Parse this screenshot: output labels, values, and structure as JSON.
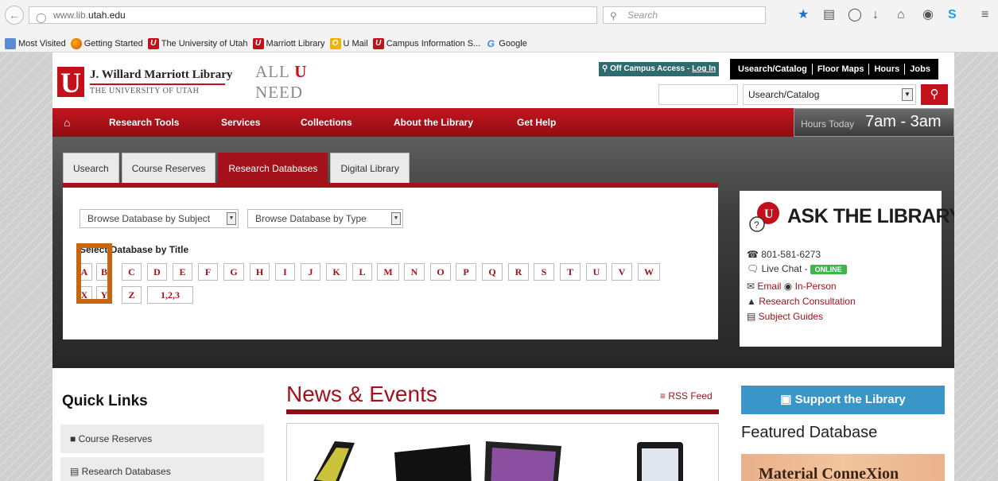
{
  "browser": {
    "url_prefix": "www.lib.",
    "url_domain": "utah.edu",
    "url_suffix": "",
    "search_placeholder": "Search",
    "bookmarks": [
      "Most Visited",
      "Getting Started",
      "The University of Utah",
      "Marriott Library",
      "U Mail",
      "Campus Information S...",
      "Google"
    ]
  },
  "header": {
    "logo_letter": "U",
    "library_name": "J. Willard Marriott Library",
    "university": "THE UNIVERSITY OF UTAH",
    "tagline_all": "ALL",
    "tagline_u": "U",
    "tagline_need": "NEED",
    "off_campus_prefix": "Off Campus Access - ",
    "off_campus_link": "Log In",
    "top_links": [
      "Usearch/Catalog",
      "Floor Maps",
      "Hours",
      "Jobs"
    ],
    "search_select": "Usearch/Catalog"
  },
  "nav": {
    "items": [
      "Research Tools",
      "Services",
      "Collections",
      "About the Library",
      "Get Help"
    ],
    "hours_label": "Hours Today",
    "hours_value": "7am - 3am"
  },
  "tabs": [
    "Usearch",
    "Course Reserves",
    "Research Databases",
    "Digital Library"
  ],
  "active_tab": "Research Databases",
  "databases": {
    "subject_select": "Browse Database by Subject",
    "type_select": "Browse Database by Type",
    "select_title": "Select Database by Title",
    "letters_row1": [
      "A",
      "B",
      "C",
      "D",
      "E",
      "F",
      "G",
      "H",
      "I",
      "J",
      "K",
      "L",
      "M",
      "N",
      "O",
      "P",
      "Q",
      "R",
      "S",
      "T",
      "U",
      "V",
      "W"
    ],
    "letters_row2": [
      "X",
      "Y",
      "Z",
      "1,2,3"
    ]
  },
  "ask": {
    "title": "ASK THE LIBRARY",
    "phone": "801-581-6273",
    "live_chat": "Live Chat -",
    "online": "ONLINE",
    "email": "Email",
    "in_person": "In-Person",
    "consultation": "Research Consultation",
    "guides": "Subject Guides"
  },
  "quick_links": {
    "title": "Quick Links",
    "items": [
      "Course Reserves",
      "Research Databases"
    ]
  },
  "news": {
    "title": "News & Events",
    "rss": "RSS Feed"
  },
  "support": {
    "label": "Support the Library"
  },
  "featured": {
    "title": "Featured Database",
    "name": "Material ConneXion"
  },
  "colors": {
    "brand_red": "#c2111a",
    "teal": "#2d6b6e",
    "support_blue": "#3a95c8",
    "highlight_orange": "#c8650f"
  }
}
